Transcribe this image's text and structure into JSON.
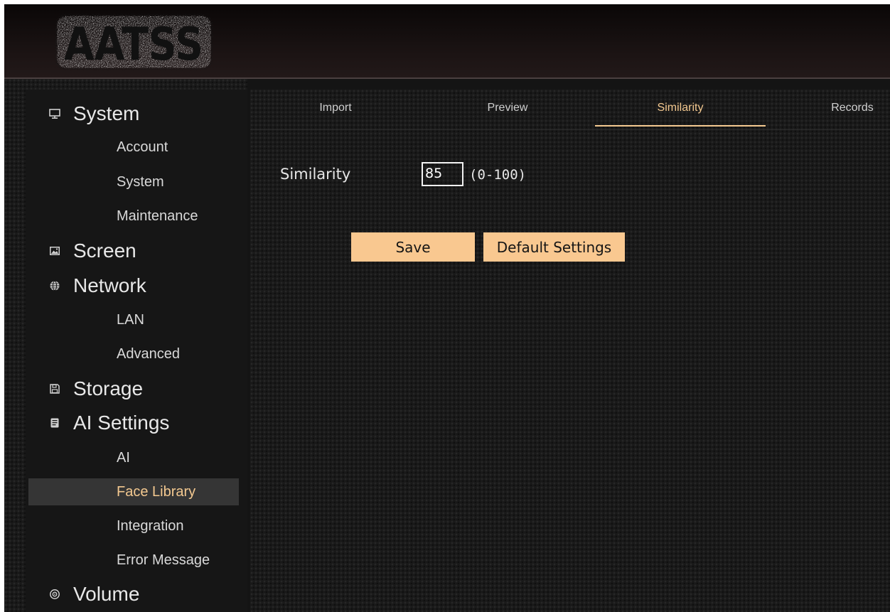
{
  "header": {
    "logo_text": "AATSS"
  },
  "sidebar": {
    "sections": [
      {
        "label": "System",
        "icon": "monitor-icon",
        "items": [
          "Account",
          "System",
          "Maintenance"
        ]
      },
      {
        "label": "Screen",
        "icon": "image-icon",
        "items": []
      },
      {
        "label": "Network",
        "icon": "globe-icon",
        "items": [
          "LAN",
          "Advanced"
        ]
      },
      {
        "label": "Storage",
        "icon": "save-icon",
        "items": []
      },
      {
        "label": "AI Settings",
        "icon": "document-icon",
        "items": [
          "AI",
          "Face Library",
          "Integration",
          "Error Message"
        ]
      },
      {
        "label": "Volume",
        "icon": "speaker-icon",
        "items": []
      }
    ],
    "active_item": "Face Library"
  },
  "tabs": [
    "Import",
    "Preview",
    "Similarity",
    "Records"
  ],
  "active_tab": "Similarity",
  "form": {
    "similarity_label": "Similarity",
    "similarity_value": "85",
    "range_hint": "(0-100)",
    "save_label": "Save",
    "default_label": "Default Settings"
  },
  "colors": {
    "accent": "#f4c990",
    "button_bg": "#f9c890",
    "active_item_bg": "#353535",
    "background": "#141414"
  }
}
